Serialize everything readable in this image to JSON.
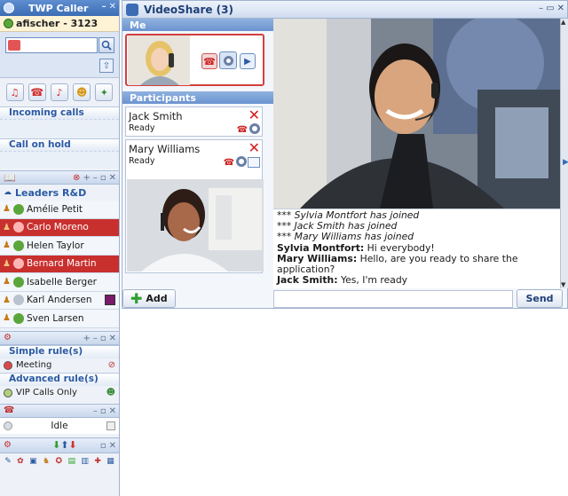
{
  "sidebar": {
    "app_title": "TWP Caller",
    "user": "afischer - 3123",
    "search": {
      "value": "",
      "placeholder": ""
    },
    "incoming_calls": "Incoming calls",
    "call_on_hold": "Call on hold",
    "group_title": "Leaders R&D",
    "contacts": [
      {
        "name": "Amélie Petit",
        "status": "available",
        "highlight": false
      },
      {
        "name": "Carlo Moreno",
        "status": "busy",
        "highlight": true
      },
      {
        "name": "Helen Taylor",
        "status": "available",
        "highlight": false
      },
      {
        "name": "Bernard Martin",
        "status": "busy",
        "highlight": true
      },
      {
        "name": "Isabelle Berger",
        "status": "available",
        "highlight": false
      },
      {
        "name": "Karl Andersen",
        "status": "away",
        "highlight": false
      },
      {
        "name": "Sven Larsen",
        "status": "available",
        "highlight": false
      }
    ],
    "simple_rules_title": "Simple rule(s)",
    "simple_rule": "Meeting",
    "advanced_rules_title": "Advanced rule(s)",
    "advanced_rule": "VIP Calls Only",
    "presence_status": "Idle"
  },
  "window": {
    "title": "VideoShare (3)",
    "me_label": "Me",
    "participants_label": "Participants",
    "participants": [
      {
        "name": "Jack Smith",
        "status": "Ready"
      },
      {
        "name": "Mary Williams",
        "status": "Ready"
      }
    ],
    "add_label": "Add",
    "send_label": "Send",
    "chat_input": {
      "value": "",
      "placeholder": ""
    },
    "chat": [
      {
        "system": true,
        "text": "*** Sylvia Montfort has joined"
      },
      {
        "system": true,
        "text": "*** Jack Smith  has joined"
      },
      {
        "system": true,
        "text": "*** Mary Williams has joined"
      },
      {
        "system": false,
        "sender": "Sylvia Montfort:",
        "text": " Hi everybody!"
      },
      {
        "system": false,
        "sender": "Mary Williams:",
        "text": " Hello, are you ready to share the application?"
      },
      {
        "system": false,
        "sender": "Jack Smith:",
        "text": " Yes, I'm ready"
      }
    ]
  },
  "colors": {
    "accent": "#3c6cb4",
    "busy": "#c8302e",
    "remove": "#d41e1e",
    "add": "#2e9e2e"
  }
}
